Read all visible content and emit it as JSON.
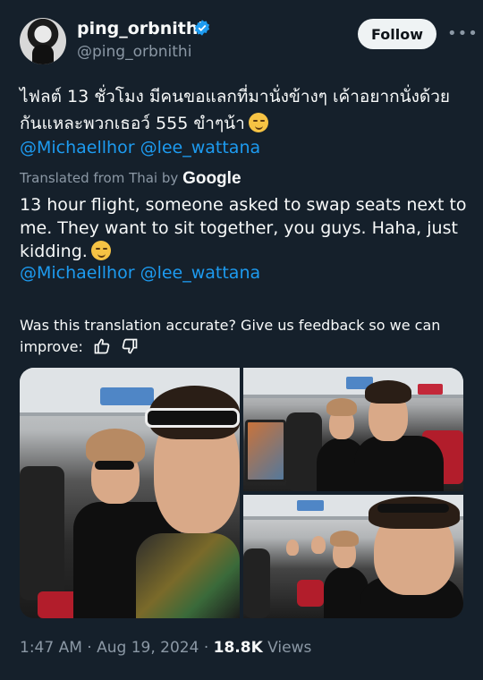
{
  "author": {
    "display_name": "ping_orbnithi",
    "handle": "@ping_orbnithi",
    "verified_icon": "verified-badge-icon",
    "verified_color": "#1d9bf0"
  },
  "actions": {
    "follow_label": "Follow",
    "more_label": "•••"
  },
  "tweet": {
    "thai_text": "ไฟลต์ 13 ชั่วโมง มีคนขอแลกที่มานั่งข้างๆ เค้าอยากนั่งด้วยกันแหละพวกเธอว์ 555 ขำๆน้า",
    "mentions": "@Michaellhor @lee_wattana",
    "translated_prefix": "Translated from Thai by",
    "translated_brand": "Google",
    "english_text": "13 hour flight, someone asked to swap seats next to me. They want to sit together, you guys. Haha, just kidding.",
    "english_mentions": "@Michaellhor @lee_wattana",
    "emoji": "smirking-face-emoji"
  },
  "feedback": {
    "text": "Was this translation accurate? Give us feedback so we can improve:",
    "thumbs_up_icon": "thumbs-up-icon",
    "thumbs_down_icon": "thumbs-down-icon"
  },
  "media": {
    "photo_count": 3
  },
  "meta": {
    "time": "1:47 AM",
    "separator": "·",
    "date": "Aug 19, 2024",
    "views_count": "18.8K",
    "views_label": "Views"
  },
  "colors": {
    "background": "#15202b",
    "link": "#1d9bf0",
    "muted": "#8b98a5",
    "text": "#f7f9f9"
  }
}
